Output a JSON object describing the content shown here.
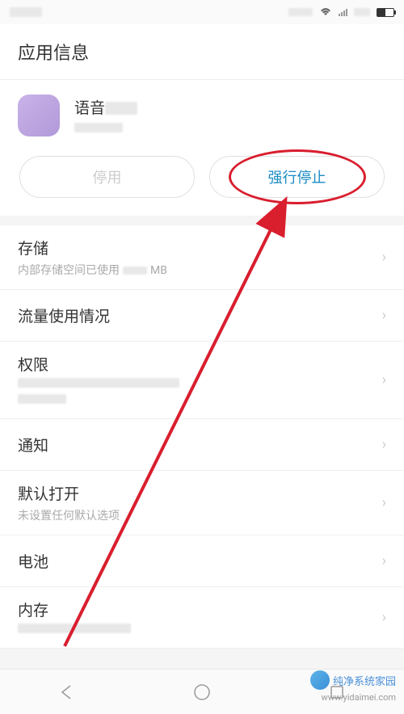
{
  "header": {
    "title": "应用信息"
  },
  "app": {
    "name": "语音"
  },
  "buttons": {
    "disable": "停用",
    "force_stop": "强行停止"
  },
  "settings": {
    "storage": {
      "label": "存储",
      "sublabel_prefix": "内部存储空间已使用",
      "sublabel_suffix": "MB"
    },
    "data_usage": {
      "label": "流量使用情况"
    },
    "permissions": {
      "label": "权限"
    },
    "notifications": {
      "label": "通知"
    },
    "default_open": {
      "label": "默认打开",
      "sublabel": "未设置任何默认选项"
    },
    "battery": {
      "label": "电池"
    },
    "memory": {
      "label": "内存"
    }
  },
  "watermark": {
    "text": "纯净系统家园",
    "url": "www.yidaimei.com"
  }
}
